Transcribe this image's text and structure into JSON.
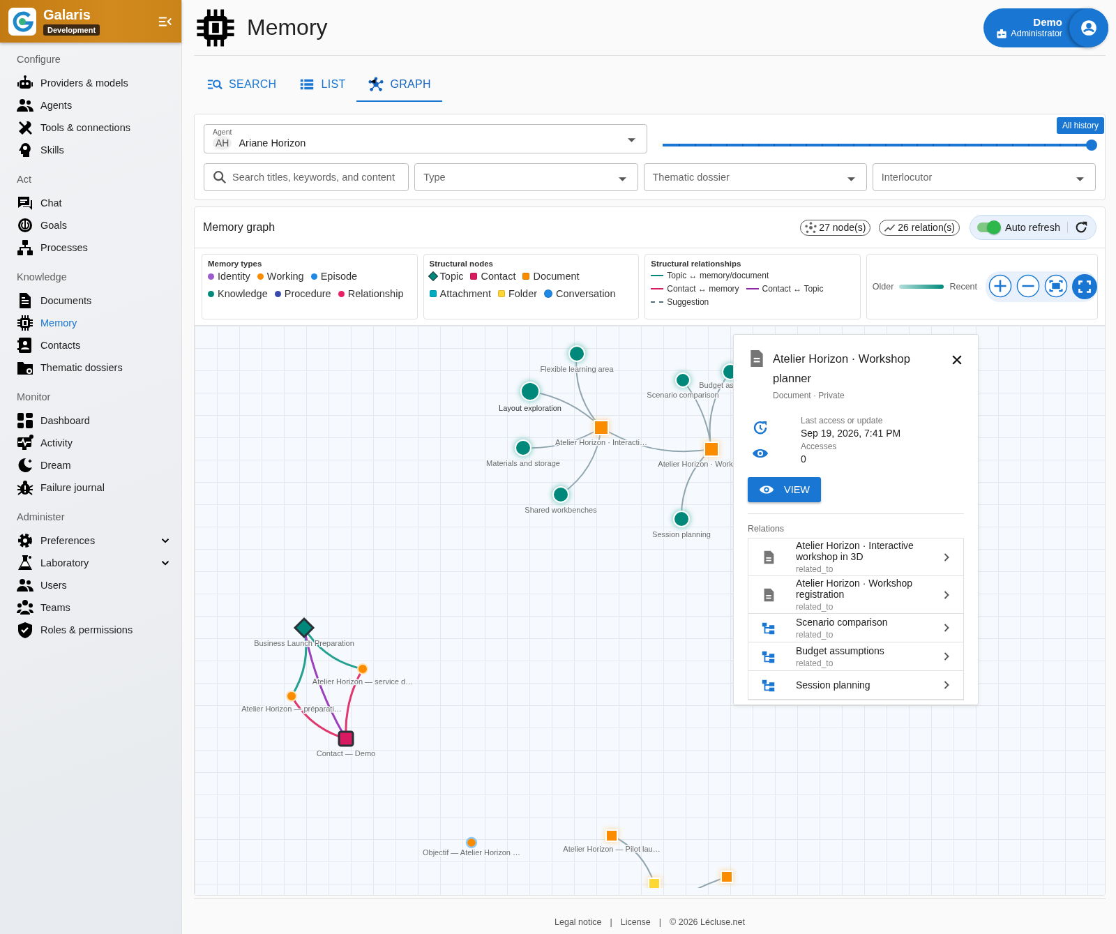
{
  "sidebar": {
    "app_name": "Galaris",
    "environment": "Development",
    "sections": [
      {
        "title": "Configure",
        "items": [
          {
            "label": "Providers & models",
            "kind": "link",
            "selected": false
          },
          {
            "label": "Agents",
            "kind": "link",
            "selected": false
          },
          {
            "label": "Tools & connections",
            "kind": "link",
            "selected": false
          },
          {
            "label": "Skills",
            "kind": "link",
            "selected": false
          }
        ]
      },
      {
        "title": "Act",
        "items": [
          {
            "label": "Chat",
            "kind": "link",
            "selected": false
          },
          {
            "label": "Goals",
            "kind": "link",
            "selected": false
          },
          {
            "label": "Processes",
            "kind": "link",
            "selected": false
          }
        ]
      },
      {
        "title": "Knowledge",
        "items": [
          {
            "label": "Documents",
            "kind": "link",
            "selected": false
          },
          {
            "label": "Memory",
            "kind": "link",
            "selected": true
          },
          {
            "label": "Contacts",
            "kind": "link",
            "selected": false
          },
          {
            "label": "Thematic dossiers",
            "kind": "link",
            "selected": false
          }
        ]
      },
      {
        "title": "Monitor",
        "items": [
          {
            "label": "Dashboard",
            "kind": "link",
            "selected": false
          },
          {
            "label": "Activity",
            "kind": "link",
            "selected": false
          },
          {
            "label": "Dream",
            "kind": "link",
            "selected": false
          },
          {
            "label": "Failure journal",
            "kind": "link",
            "selected": false
          }
        ]
      },
      {
        "title": "Administer",
        "items": [
          {
            "label": "Preferences",
            "kind": "group",
            "selected": false
          },
          {
            "label": "Laboratory",
            "kind": "group",
            "selected": false
          },
          {
            "label": "Users",
            "kind": "link",
            "selected": false
          },
          {
            "label": "Teams",
            "kind": "link",
            "selected": false
          },
          {
            "label": "Roles & permissions",
            "kind": "link",
            "selected": false
          }
        ]
      }
    ]
  },
  "page": {
    "title": "Memory"
  },
  "user": {
    "name": "Demo",
    "role": "Administrator"
  },
  "tabs": [
    {
      "label": "SEARCH",
      "selected": false
    },
    {
      "label": "LIST",
      "selected": false
    },
    {
      "label": "GRAPH",
      "selected": true
    }
  ],
  "filters": {
    "agent": {
      "label": "Agent",
      "initials": "AH",
      "value": "Ariane Horizon"
    },
    "history": {
      "tooltip": "All history",
      "level": 1
    },
    "search": {
      "placeholder": "Search titles, keywords, and content"
    },
    "selects": [
      {
        "placeholder": "Type"
      },
      {
        "placeholder": "Thematic dossier"
      },
      {
        "placeholder": "Interlocutor"
      }
    ]
  },
  "graph": {
    "title": "Memory graph",
    "nodes_count": "27 node(s)",
    "relations_count": "26 relation(s)",
    "auto_refresh": {
      "label": "Auto refresh",
      "on": true
    },
    "legend": {
      "memory_types": {
        "title": "Memory types",
        "items": [
          {
            "label": "Identity",
            "color": "#9c5ccc"
          },
          {
            "label": "Working",
            "color": "#fb8c00"
          },
          {
            "label": "Episode",
            "color": "#1e88e5"
          },
          {
            "label": "Knowledge",
            "color": "#00897b"
          },
          {
            "label": "Procedure",
            "color": "#3949ab"
          },
          {
            "label": "Relationship",
            "color": "#e91e63"
          }
        ]
      },
      "structural_nodes": {
        "title": "Structural nodes",
        "items": [
          {
            "label": "Topic",
            "color": "#00897b",
            "kind": "diamond"
          },
          {
            "label": "Contact",
            "color": "#d81b60",
            "kind": "square"
          },
          {
            "label": "Document",
            "color": "#fb8c00",
            "kind": "square"
          },
          {
            "label": "Attachment",
            "color": "#00acc1",
            "kind": "square"
          },
          {
            "label": "Folder",
            "color": "#fdd835",
            "kind": "square"
          },
          {
            "label": "Conversation",
            "color": "#1e88e5",
            "kind": "circle"
          }
        ]
      },
      "relationships": {
        "title": "Structural relationships",
        "items": [
          {
            "label": "Topic ↔ memory/document",
            "color": "#00897b",
            "kind": "solid"
          },
          {
            "label": "Contact ↔ memory",
            "color": "#d81b60",
            "kind": "solid"
          },
          {
            "label": "Contact ↔ Topic",
            "color": "#8e24aa",
            "kind": "solid"
          },
          {
            "label": "Suggestion",
            "color": "#546e7a",
            "kind": "dashed"
          }
        ]
      },
      "timeline": {
        "older": "Older",
        "recent": "Recent"
      }
    },
    "nodes": [
      {
        "label": "Flexible learning area",
        "kind": "knowledge"
      },
      {
        "label": "Layout exploration",
        "kind": "knowledge"
      },
      {
        "label": "Atelier Horizon · Interacti…",
        "kind": "document"
      },
      {
        "label": "Materials and storage",
        "kind": "knowledge"
      },
      {
        "label": "Shared workbenches",
        "kind": "knowledge"
      },
      {
        "label": "Budget as",
        "kind": "knowledge"
      },
      {
        "label": "Scenario comparison",
        "kind": "knowledge"
      },
      {
        "label": "Atelier Horizon · Work",
        "kind": "document"
      },
      {
        "label": "Session planning",
        "kind": "knowledge"
      },
      {
        "label": "Business Launch Preparation",
        "kind": "topic"
      },
      {
        "label": "Atelier Horizon — service d…",
        "kind": "working"
      },
      {
        "label": "Atelier Horizon — préparati…",
        "kind": "working"
      },
      {
        "label": "Contact — Demo",
        "kind": "contact"
      },
      {
        "label": "Objectif — Atelier Horizon …",
        "kind": "goal"
      },
      {
        "label": "Atelier Horizon — Pilot lau…",
        "kind": "document"
      },
      {
        "kind": "folder"
      },
      {
        "kind": "document"
      }
    ],
    "detail": {
      "title": "Atelier Horizon · Workshop planner",
      "subtitle": "Document · Private",
      "last_access_label": "Last access or update",
      "last_access": "Sep 19, 2026, 7:41 PM",
      "accesses_label": "Accesses",
      "accesses": "0",
      "view_button": "VIEW",
      "relations_title": "Relations",
      "relations": [
        {
          "title": "Atelier Horizon · Interactive workshop in 3D",
          "type": "related_to",
          "kind": "document"
        },
        {
          "title": "Atelier Horizon · Workshop registration",
          "type": "related_to",
          "kind": "document"
        },
        {
          "title": "Scenario comparison",
          "type": "related_to",
          "kind": "knowledge"
        },
        {
          "title": "Budget assumptions",
          "type": "related_to",
          "kind": "knowledge"
        },
        {
          "title": "Session planning",
          "kind": "knowledge"
        }
      ]
    }
  },
  "footer": [
    "Legal notice",
    "|",
    "License",
    "|",
    "© 2026 Lécluse.net"
  ]
}
